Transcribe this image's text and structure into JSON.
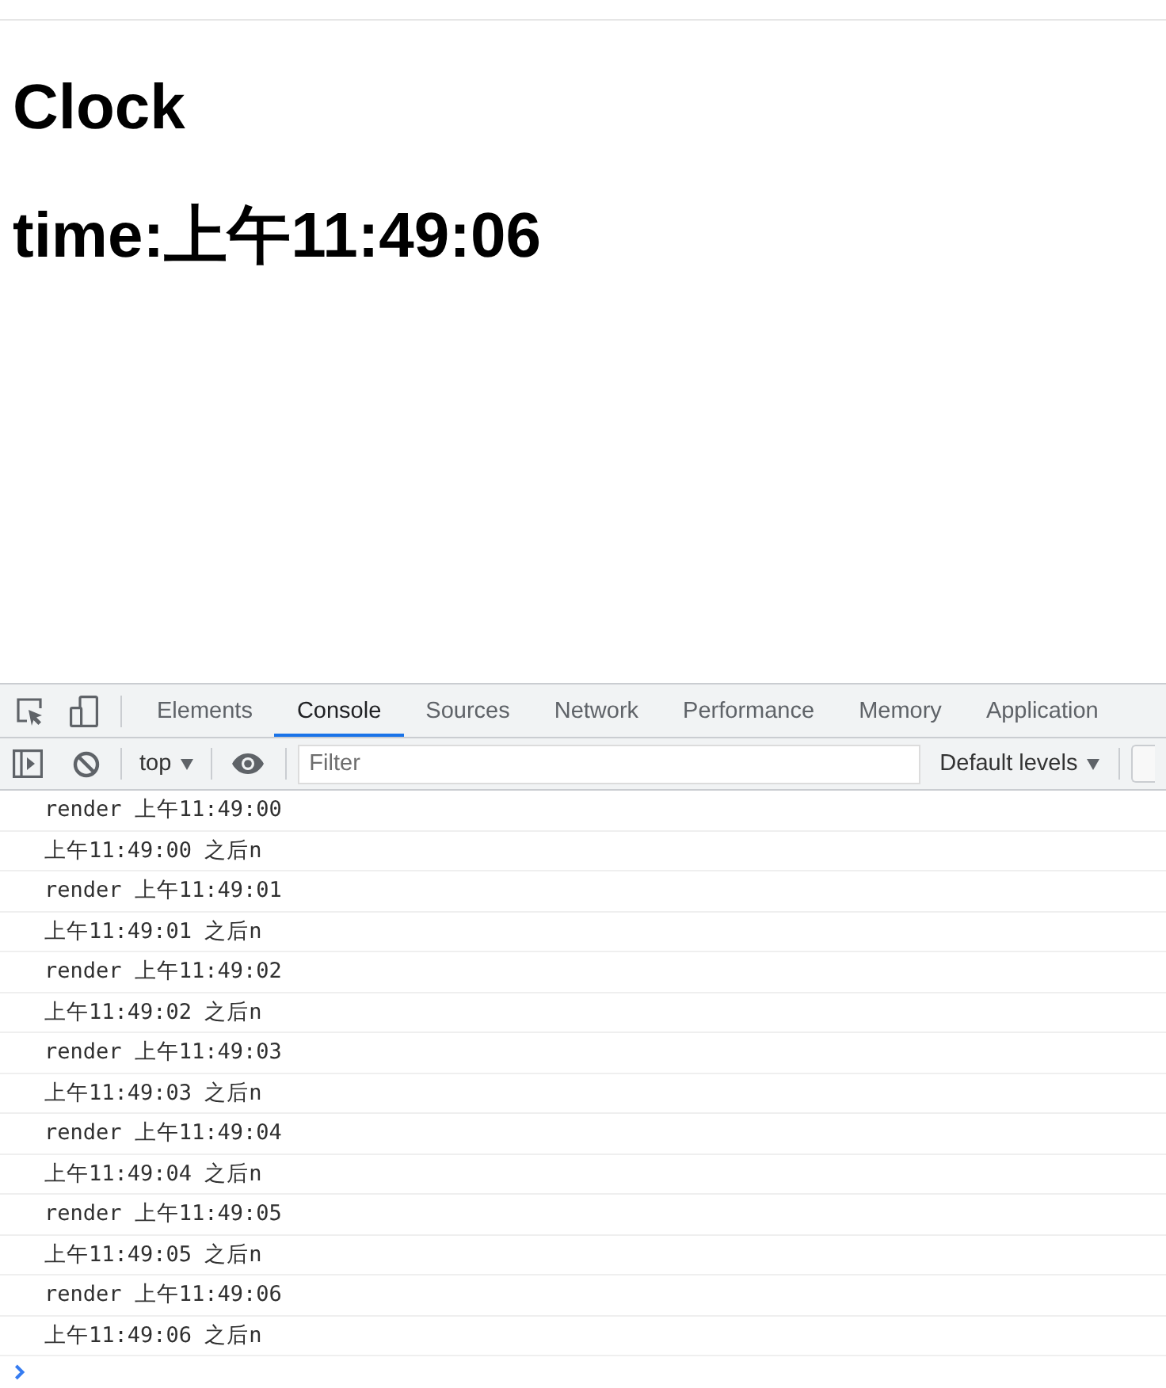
{
  "page": {
    "title": "Clock",
    "time_line": "time:上午11:49:06"
  },
  "devtools": {
    "tabs": [
      {
        "label": "Elements",
        "selected": false
      },
      {
        "label": "Console",
        "selected": true
      },
      {
        "label": "Sources",
        "selected": false
      },
      {
        "label": "Network",
        "selected": false
      },
      {
        "label": "Performance",
        "selected": false
      },
      {
        "label": "Memory",
        "selected": false
      },
      {
        "label": "Application",
        "selected": false
      }
    ],
    "toolbar": {
      "context": "top",
      "filter": {
        "placeholder": "Filter"
      },
      "levels": "Default levels"
    },
    "console": {
      "messages": [
        {
          "text": "render 上午11:49:00"
        },
        {
          "text": "上午11:49:00 之后n"
        },
        {
          "text": "render 上午11:49:01"
        },
        {
          "text": "上午11:49:01 之后n"
        },
        {
          "text": "render 上午11:49:02"
        },
        {
          "text": "上午11:49:02 之后n"
        },
        {
          "text": "render 上午11:49:03"
        },
        {
          "text": "上午11:49:03 之后n"
        },
        {
          "text": "render 上午11:49:04"
        },
        {
          "text": "上午11:49:04 之后n"
        },
        {
          "text": "render 上午11:49:05"
        },
        {
          "text": "上午11:49:05 之后n"
        },
        {
          "text": "render 上午11:49:06"
        },
        {
          "text": "上午11:49:06 之后n"
        }
      ]
    }
  }
}
